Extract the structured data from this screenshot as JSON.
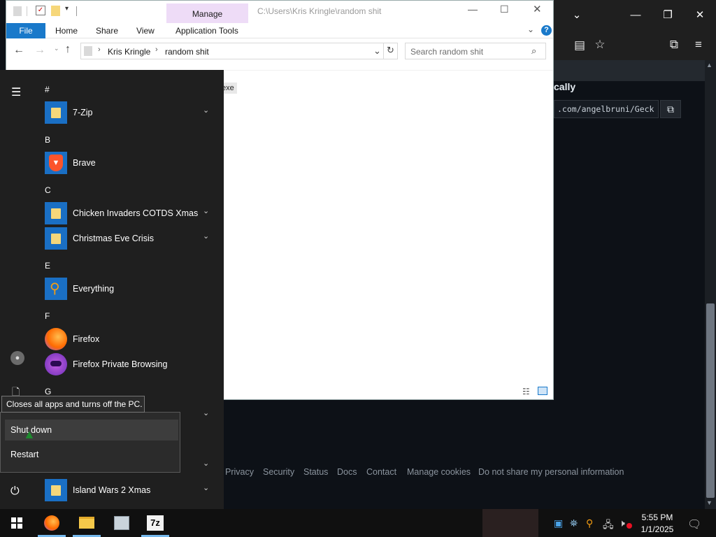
{
  "explorer": {
    "path_title": "C:\\Users\\Kris Kringle\\random shit",
    "manage_label": "Manage",
    "tabs": [
      "File",
      "Home",
      "Share",
      "View",
      "Application Tools"
    ],
    "breadcrumb": [
      "Kris Kringle",
      "random shit"
    ],
    "search_placeholder": "Search random shit",
    "file_fragment": "exe"
  },
  "start_menu": {
    "groups": [
      {
        "letter": "#",
        "apps": [
          {
            "name": "7-Zip",
            "icon": "folder-icon",
            "expandable": true
          }
        ]
      },
      {
        "letter": "B",
        "apps": [
          {
            "name": "Brave",
            "icon": "brave-icon",
            "expandable": false
          }
        ]
      },
      {
        "letter": "C",
        "apps": [
          {
            "name": "Chicken Invaders COTDS Xmas",
            "icon": "folder-icon",
            "expandable": true
          },
          {
            "name": "Christmas Eve Crisis",
            "icon": "folder-icon",
            "expandable": true
          }
        ]
      },
      {
        "letter": "E",
        "apps": [
          {
            "name": "Everything",
            "icon": "magnifier-icon",
            "expandable": false
          }
        ]
      },
      {
        "letter": "F",
        "apps": [
          {
            "name": "Firefox",
            "icon": "firefox-icon",
            "expandable": false
          },
          {
            "name": "Firefox Private Browsing",
            "icon": "firefox-private-icon",
            "expandable": false
          }
        ]
      },
      {
        "letter": "G",
        "apps": []
      },
      {
        "letter": "",
        "apps": [
          {
            "name": "Island Wars 2 Xmas",
            "icon": "folder-icon",
            "expandable": true
          }
        ]
      }
    ],
    "tooltip": "Closes all apps and turns off the PC.",
    "power_menu": [
      "Shut down",
      "Restart"
    ]
  },
  "browser": {
    "heading_fragment": "cally",
    "url_fragment": ".com/angelbruni/Geck",
    "footer_links": [
      "Privacy",
      "Security",
      "Status",
      "Docs",
      "Contact",
      "Manage cookies",
      "Do not share my personal information"
    ]
  },
  "taskbar": {
    "apps": [
      "start-icon",
      "firefox-icon",
      "file-explorer-icon",
      "network-icon",
      "7zip-icon"
    ],
    "time": "5:55 PM",
    "date": "1/1/2025"
  },
  "colors": {
    "accent": "#1979ca",
    "start_bg": "#1f1f1f",
    "manage_bg": "#eedcf7"
  }
}
